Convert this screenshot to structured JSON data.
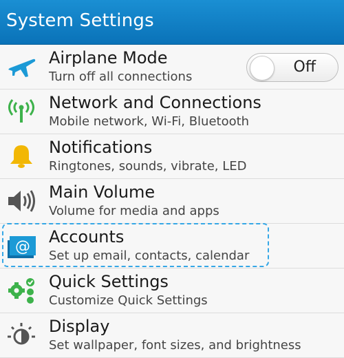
{
  "header": {
    "title": "System Settings"
  },
  "settings": [
    {
      "label": "Airplane Mode",
      "sub": "Turn off all connections",
      "icon": "airplane-icon",
      "toggle": "Off"
    },
    {
      "label": "Network and Connections",
      "sub": "Mobile network, Wi-Fi, Bluetooth",
      "icon": "antenna-icon"
    },
    {
      "label": "Notifications",
      "sub": "Ringtones, sounds, vibrate, LED",
      "icon": "bell-icon"
    },
    {
      "label": "Main Volume",
      "sub": "Volume for media and apps",
      "icon": "speaker-icon"
    },
    {
      "label": "Accounts",
      "sub": "Set up email, contacts, calendar",
      "icon": "at-sign-icon",
      "focused": true
    },
    {
      "label": "Quick Settings",
      "sub": "Customize Quick Settings",
      "icon": "quick-settings-icon"
    },
    {
      "label": "Display",
      "sub": "Set wallpaper, font sizes, and brightness",
      "icon": "brightness-icon"
    }
  ],
  "colors": {
    "header": "#0a72b8",
    "accent": "#35a7e6",
    "icon_blue": "#1c9ad6",
    "icon_green": "#3db24b",
    "icon_yellow": "#f2b705"
  }
}
